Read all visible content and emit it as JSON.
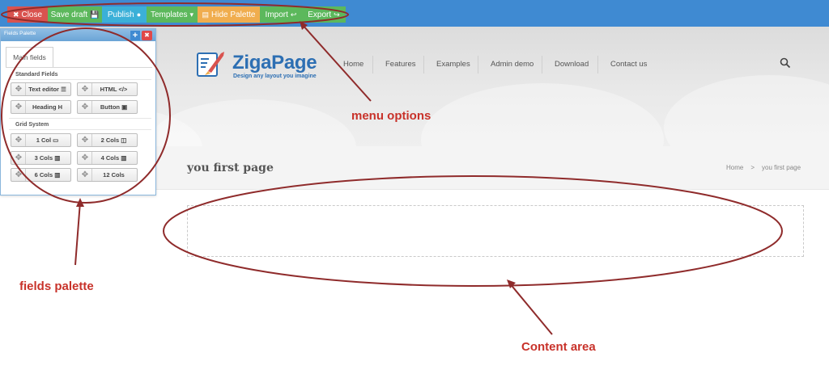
{
  "toolbar": {
    "close": "Close",
    "save_draft": "Save draft",
    "publish": "Publish",
    "templates": "Templates",
    "hide_palette": "Hide Palette",
    "import": "Import",
    "export": "Export"
  },
  "site": {
    "brand": "ZigaPage",
    "tagline": "Design any layout you imagine",
    "nav": [
      "Home",
      "Features",
      "Examples",
      "Admin demo",
      "Download",
      "Contact us"
    ]
  },
  "page": {
    "title": "you first page",
    "breadcrumb": [
      "Home",
      ">",
      "you first page"
    ]
  },
  "palette": {
    "title": "Fields Palette",
    "tab": "Main fields",
    "standard_heading": "Standard Fields",
    "grid_heading": "Grid System",
    "standard": [
      "Text editor",
      "HTML",
      "Heading",
      "Button"
    ],
    "grid": [
      "1 Col",
      "2 Cols",
      "3 Cols",
      "4 Cols",
      "6 Cols",
      "12 Cols"
    ]
  },
  "annotations": {
    "menu": "menu options",
    "palette": "fields palette",
    "content": "Content area"
  },
  "colors": {
    "annotation": "#c8322a",
    "topbar": "#3f8ad2",
    "brand": "#2d6fb3"
  }
}
